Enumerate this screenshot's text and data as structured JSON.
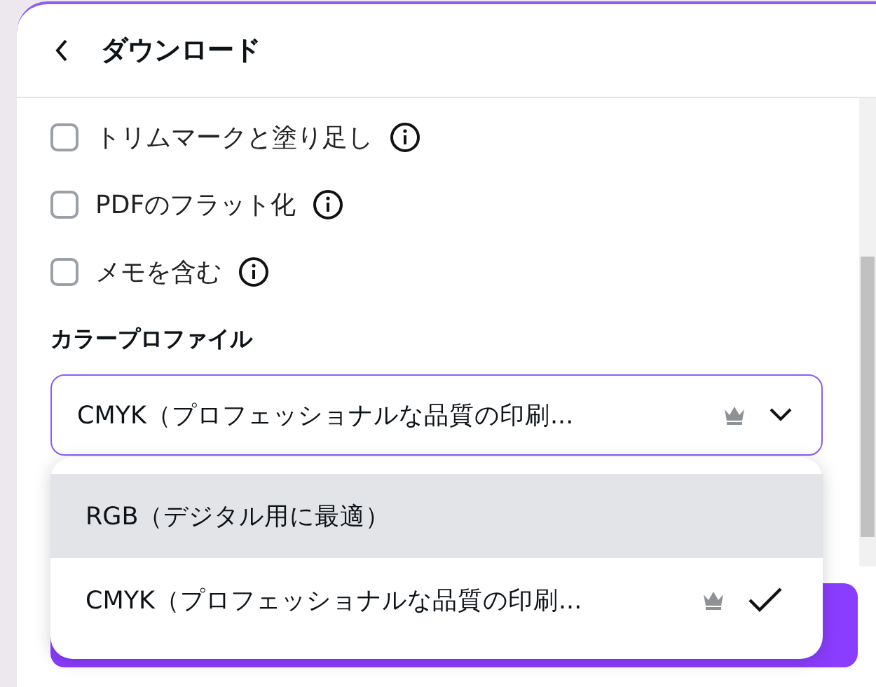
{
  "header": {
    "title": "ダウンロード"
  },
  "options": [
    {
      "label": "トリムマークと塗り足し",
      "checked": false
    },
    {
      "label": "PDFのフラット化",
      "checked": false
    },
    {
      "label": "メモを含む",
      "checked": false
    }
  ],
  "color_profile": {
    "label": "カラープロファイル",
    "value": "CMYK（プロフェッショナルな品質の印刷...",
    "premium": true
  },
  "dropdown": {
    "items": [
      {
        "label": "RGB（デジタル用に最適）",
        "premium": false,
        "selected": false,
        "hovered": true
      },
      {
        "label": "CMYK（プロフェッショナルな品質の印刷...",
        "premium": true,
        "selected": true,
        "hovered": false
      }
    ]
  }
}
